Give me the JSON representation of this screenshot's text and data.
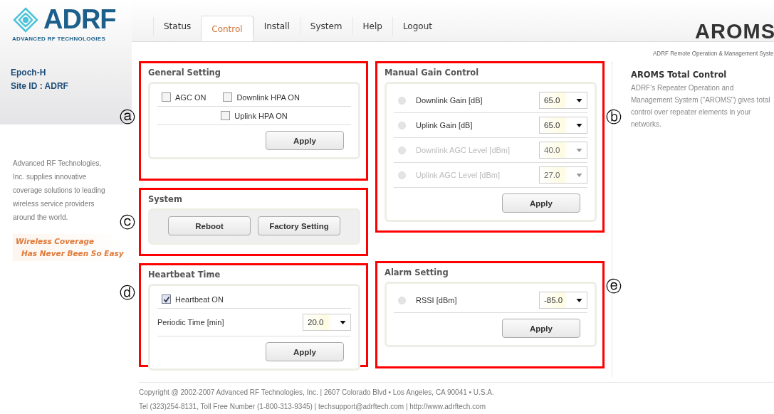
{
  "logo": {
    "wordmark": "ADRF",
    "tagline": "ADVANCED RF TECHNOLOGIES"
  },
  "device": {
    "model": "Epoch-H",
    "site": "Site ID : ADRF"
  },
  "about": "Advanced RF Technologies, Inc. supplies innovative coverage solutions to leading wireless service providers around the world.",
  "slogan": [
    "Wireless Coverage",
    "Has Never Been So Easy"
  ],
  "tabs": [
    {
      "label": "Status",
      "selected": false
    },
    {
      "label": "Control",
      "selected": true
    },
    {
      "label": "Install",
      "selected": false
    },
    {
      "label": "System",
      "selected": false
    },
    {
      "label": "Help",
      "selected": false
    },
    {
      "label": "Logout",
      "selected": false
    }
  ],
  "brand": {
    "title": "AROMS",
    "subtitle": "ADRF Remote Operation & Management Syste"
  },
  "info": {
    "title": "AROMS Total Control",
    "text": "ADRF's Repeater Operation and Management System (\"AROMS\") gives total control over repeater elements in your networks."
  },
  "general_setting": {
    "title": "General Setting",
    "callout": "ⓐ",
    "checkboxes": [
      {
        "label": "AGC ON",
        "checked": false
      },
      {
        "label": "Downlink HPA ON",
        "checked": false
      },
      {
        "label": "Uplink HPA ON",
        "checked": false
      }
    ],
    "button": "Apply"
  },
  "system": {
    "title": "System",
    "callout": "ⓒ",
    "buttons": [
      "Reboot",
      "Factory Setting"
    ]
  },
  "heartbeat": {
    "title": "Heartbeat Time",
    "callout": "ⓓ",
    "checkbox": {
      "label": "Heartbeat ON",
      "checked": true
    },
    "field": {
      "label": "Periodic Time [min]",
      "value": "20.0"
    },
    "button": "Apply"
  },
  "manual_gain": {
    "title": "Manual Gain Control",
    "callout": "ⓑ",
    "rows": [
      {
        "label": "Downlink Gain [dB]",
        "value": "65.0",
        "disabled": false,
        "selected": false
      },
      {
        "label": "Uplink Gain [dB]",
        "value": "65.0",
        "disabled": false,
        "selected": false
      },
      {
        "label": "Downlink AGC Level [dBm]",
        "value": "40.0",
        "disabled": true,
        "selected": false
      },
      {
        "label": "Uplink AGC Level [dBm]",
        "value": "27.0",
        "disabled": true,
        "selected": false
      }
    ],
    "button": "Apply"
  },
  "alarm": {
    "title": "Alarm Setting",
    "callout": "ⓔ",
    "rows": [
      {
        "label": "RSSI [dBm]",
        "value": "-85.0",
        "disabled": false,
        "selected": false
      }
    ],
    "button": "Apply"
  },
  "footer": [
    "Copyright @ 2002-2007 Advanced RF Technologies, Inc. | 2607 Colorado Blvd • Los Angeles, CA 90041 • U.S.A.",
    "Tel (323)254-8131, Toll Free Number (1-800-313-9345) | techsupport@adrftech.com | http://www.adrftech.com"
  ]
}
